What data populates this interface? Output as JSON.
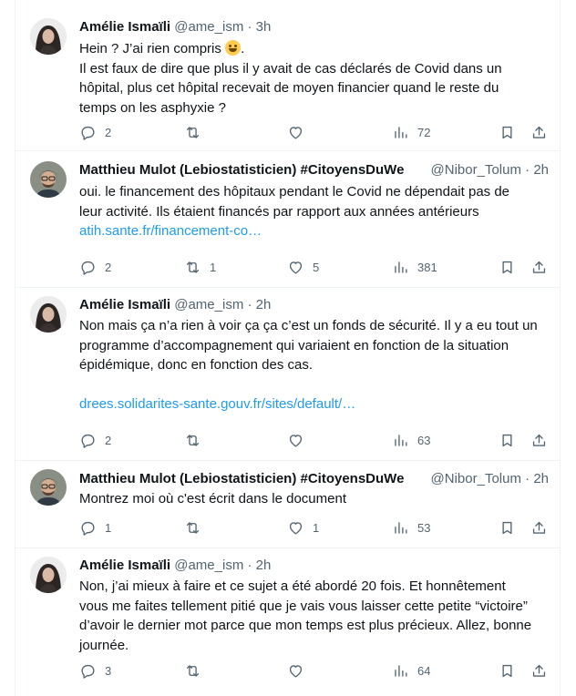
{
  "tweets": [
    {
      "name": "Amélie Ismaïli",
      "handle": "@ame_ism",
      "separator": "·",
      "time": "3h",
      "avatar_icon": "avatar-woman-icon",
      "lines": [
        "Hein ? J’ai rien compris",
        "Il est faux de dire que plus il y avait de cas déclarés de Covid dans un",
        "hôpital,  plus cet hôpital recevait de moyen financier quand le reste du",
        "temps on les asphyxie ?"
      ],
      "emoji": "sweat-smile-emoji",
      "reply_count": "2",
      "retweet_count": "",
      "like_count": "",
      "view_count": "72"
    },
    {
      "name": "Matthieu Mulot (Lebiostatisticien) #CitoyensDuWe",
      "handle": "@Nibor_Tolum",
      "separator": "·",
      "time": "2h",
      "avatar_icon": "avatar-man-icon",
      "lines": [
        "oui. le financement des hôpitaux pendant le Covid ne dépendait pas de",
        "leur activité. Ils étaient financés par rapport aux années antérieurs"
      ],
      "link": "atih.sante.fr/financement-co…",
      "reply_count": "2",
      "retweet_count": "1",
      "like_count": "5",
      "view_count": "381"
    },
    {
      "name": "Amélie Ismaïli",
      "handle": "@ame_ism",
      "separator": "·",
      "time": "2h",
      "avatar_icon": "avatar-woman-icon",
      "lines": [
        "Non mais ça n’a rien à voir ça ça c’est un fonds de sécurité. Il y a eu tout un",
        "programme d’accompagnement qui variaient en fonction de la situation",
        "épidémique, donc en fonction des cas."
      ],
      "link": "drees.solidarites-sante.gouv.fr/sites/default/…",
      "reply_count": "2",
      "retweet_count": "",
      "like_count": "",
      "view_count": "63"
    },
    {
      "name": "Matthieu Mulot (Lebiostatisticien) #CitoyensDuWe",
      "handle": "@Nibor_Tolum",
      "separator": "·",
      "time": "2h",
      "avatar_icon": "avatar-man-icon",
      "lines": [
        "Montrez moi où c'est écrit dans le document"
      ],
      "reply_count": "1",
      "retweet_count": "",
      "like_count": "1",
      "view_count": "53"
    },
    {
      "name": "Amélie Ismaïli",
      "handle": "@ame_ism",
      "separator": "·",
      "time": "2h",
      "avatar_icon": "avatar-woman-icon",
      "lines": [
        "Non, j’ai mieux à faire et ce sujet a été abordé 20 fois. Et honnêtement",
        "vous me faites tellement pitié que je vais vous laisser cette petite “victoire”",
        "d’avoir le dernier mot parce que mon temps est plus précieux. Allez, bonne",
        "journée."
      ],
      "reply_count": "3",
      "retweet_count": "",
      "like_count": "",
      "view_count": "64"
    }
  ],
  "colors": {
    "text": "#0f1419",
    "secondary": "#536471",
    "link": "#1d9bf0",
    "divider": "#eff3f4"
  }
}
